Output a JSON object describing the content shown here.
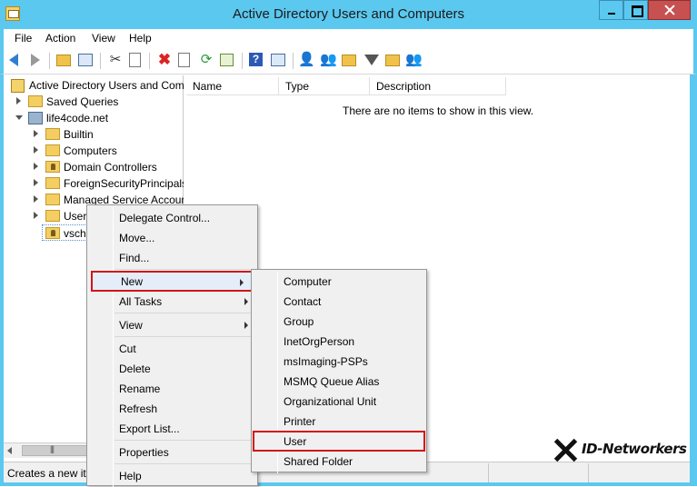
{
  "window": {
    "title": "Active Directory Users and Computers"
  },
  "menubar": {
    "items": [
      "File",
      "Action",
      "View",
      "Help"
    ]
  },
  "toolbar": {
    "icons": [
      "back-arrow-icon",
      "forward-arrow-icon",
      "up-folder-icon",
      "show-pane-icon",
      "cut-icon",
      "copy-icon",
      "delete-icon",
      "properties-icon",
      "refresh-icon",
      "export-list-icon",
      "help-icon",
      "show-action-pane-icon",
      "new-user-icon",
      "new-group-icon",
      "new-ou-icon",
      "filter-icon",
      "find-icon",
      "delegate-icon"
    ]
  },
  "tree": {
    "root": "Active Directory Users and Com",
    "saved_queries": "Saved Queries",
    "domain": "life4code.net",
    "children": [
      "Builtin",
      "Computers",
      "Domain Controllers",
      "ForeignSecurityPrincipals",
      "Managed Service Accour",
      "Users",
      "vsch"
    ]
  },
  "list": {
    "columns": [
      "Name",
      "Type",
      "Description"
    ],
    "empty_message": "There are no items to show in this view."
  },
  "status": {
    "text": "Creates a new ite"
  },
  "context_menu": {
    "items": [
      "Delegate Control...",
      "Move...",
      "Find...",
      "New",
      "All Tasks",
      "View",
      "Cut",
      "Delete",
      "Rename",
      "Refresh",
      "Export List...",
      "Properties",
      "Help"
    ]
  },
  "new_submenu": {
    "items": [
      "Computer",
      "Contact",
      "Group",
      "InetOrgPerson",
      "msImaging-PSPs",
      "MSMQ Queue Alias",
      "Organizational Unit",
      "Printer",
      "User",
      "Shared Folder"
    ]
  },
  "watermark": {
    "text": "ID-Networkers"
  },
  "colors": {
    "titlebar": "#5bc8ef",
    "highlight_border": "#d31414",
    "close_button": "#c75050"
  }
}
